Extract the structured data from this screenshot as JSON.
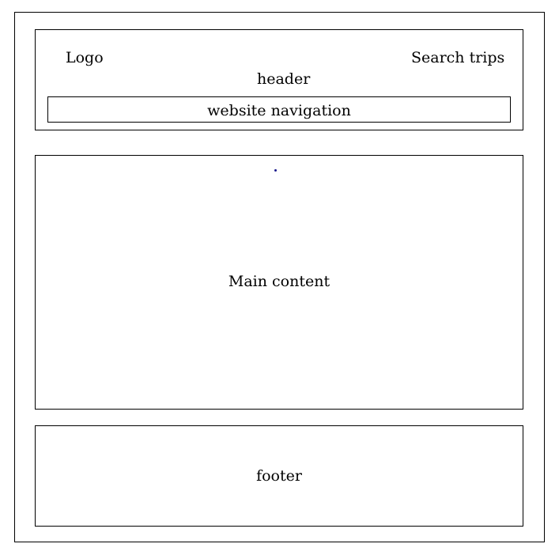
{
  "header": {
    "logo_label": "Logo",
    "search_label": "Search trips",
    "title": "header"
  },
  "navigation": {
    "label": "website navigation"
  },
  "main": {
    "label": "Main content"
  },
  "footer": {
    "label": "footer"
  },
  "colors": {
    "border": "#000000",
    "background": "#ffffff",
    "dot": "#1a1a8c"
  }
}
